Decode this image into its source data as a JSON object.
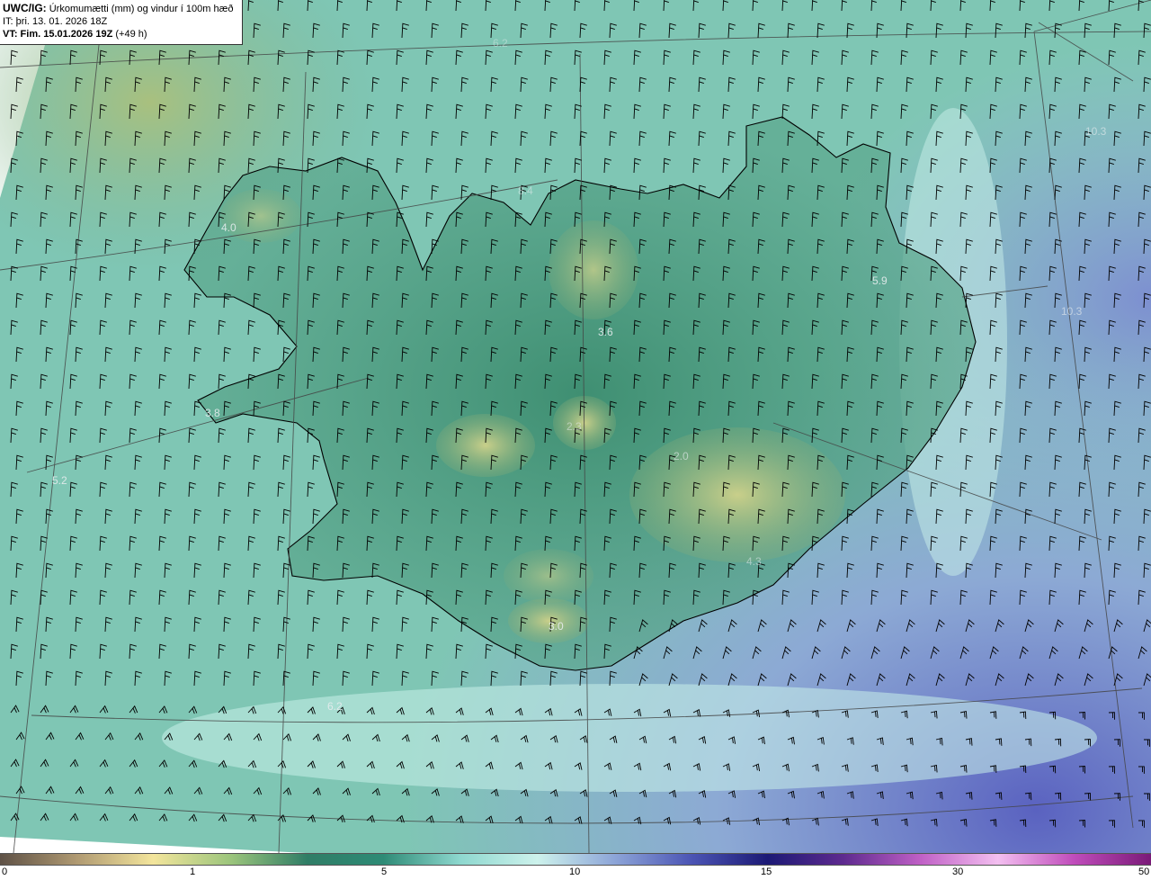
{
  "title": {
    "product": "UWC/IG:",
    "description": "Úrkomumætti (mm) og vindur í 100m hæð",
    "init_time": "IT: þri. 13. 01. 2026 18Z",
    "valid_label": "VT: Fim. 15.01.2026 19Z",
    "lead_time": "(+49 h)"
  },
  "value_labels": [
    "4.0",
    "8.4",
    "10.3",
    "5.9",
    "10.3",
    "3.6",
    "3.8",
    "5.2",
    "2.0",
    "3.0",
    "6.2",
    "4.3",
    "2.3",
    "6.2"
  ],
  "colorbar": {
    "ticks": [
      "0",
      "1",
      "5",
      "10",
      "15",
      "30",
      "50"
    ],
    "colors": [
      "#5e5146",
      "#b09a72",
      "#f3e59c",
      "#9cc57c",
      "#2f7d66",
      "#2e8b76",
      "#8ed8cf",
      "#cdf2ec",
      "#8ea6d8",
      "#4c55b5",
      "#1c1975",
      "#5e2a8f",
      "#c060c6",
      "#f3bff0",
      "#c04cbb",
      "#7a1a78"
    ]
  },
  "palette": {
    "ocean_light": "#a8e4dc",
    "ocean_teal": "#6fc1b3",
    "land_green": "#3f8f72",
    "highland_yellow": "#b9c47f",
    "sea_blue": "#8ea8dc",
    "coastline": "#000000"
  }
}
